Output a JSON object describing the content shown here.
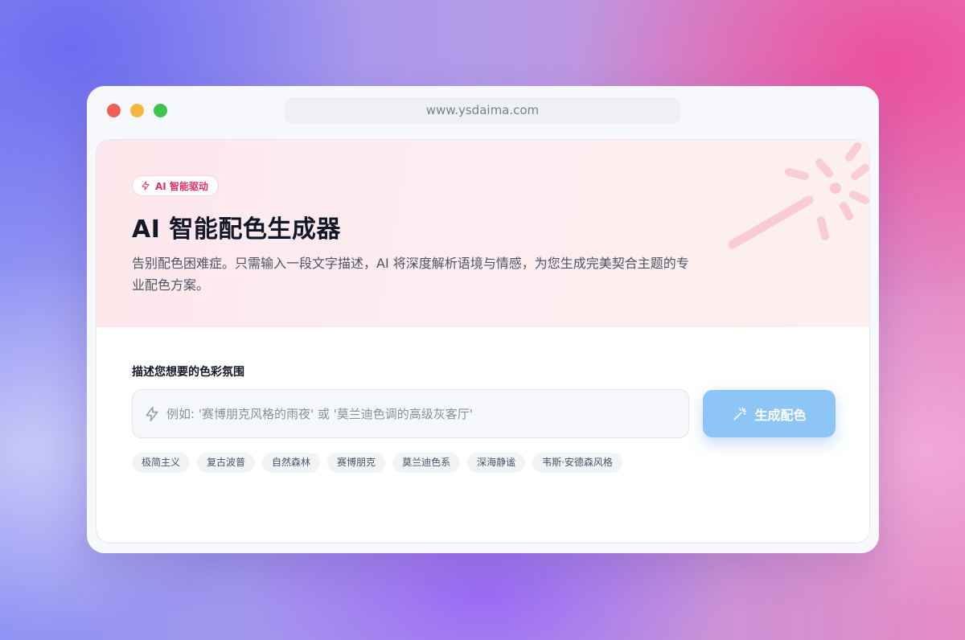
{
  "browser": {
    "url": "www.ysdaima.com"
  },
  "hero": {
    "badge": "AI 智能驱动",
    "title": "AI 智能配色生成器",
    "description": "告别配色困难症。只需输入一段文字描述，AI 将深度解析语境与情感，为您生成完美契合主题的专业配色方案。"
  },
  "form": {
    "label": "描述您想要的色彩氛围",
    "input_placeholder": "例如: '赛博朋克风格的雨夜' 或 '莫兰迪色调的高级灰客厅'",
    "input_value": "",
    "submit_label": "生成配色"
  },
  "suggestions": [
    "极简主义",
    "复古波普",
    "自然森林",
    "赛博朋克",
    "莫兰迪色系",
    "深海静谧",
    "韦斯·安德森风格"
  ],
  "colors": {
    "accent_pink": "#e0326a",
    "button_blue": "#8ec5f7",
    "close": "#ee5f57",
    "minimize": "#f4b63f",
    "maximize": "#3fc44f"
  },
  "icons": {
    "badge": "lightning-icon",
    "input": "lightning-icon",
    "button": "magic-wand-icon",
    "hero_decoration": "magic-wand-icon"
  }
}
